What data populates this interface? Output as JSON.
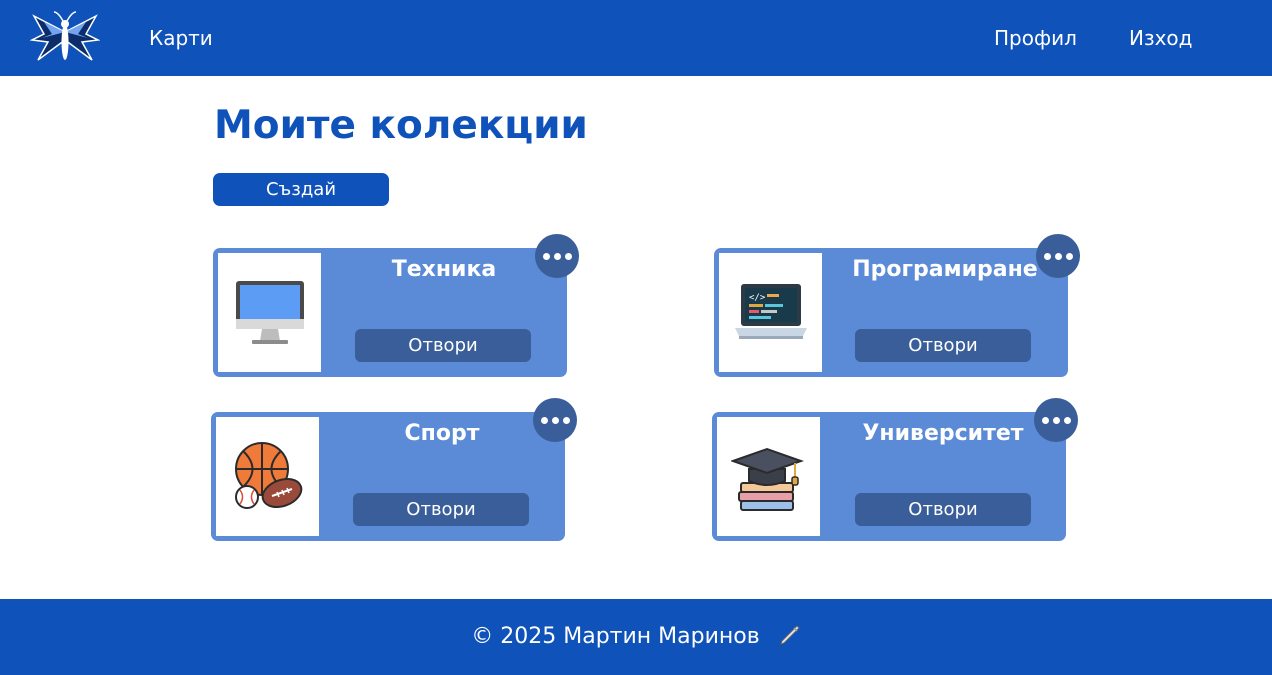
{
  "nav": {
    "logo_icon": "butterfly-logo-icon",
    "cards_label": "Карти",
    "profile_label": "Профил",
    "logout_label": "Изход"
  },
  "page": {
    "title": "Моите колекции",
    "create_label": "Създай"
  },
  "collections": [
    {
      "title": "Техника",
      "open_label": "Отвори",
      "icon": "computer-monitor-icon"
    },
    {
      "title": "Програмиране",
      "open_label": "Отвори",
      "icon": "laptop-code-icon"
    },
    {
      "title": "Спорт",
      "open_label": "Отвори",
      "icon": "sports-balls-icon"
    },
    {
      "title": "Университет",
      "open_label": "Отвори",
      "icon": "graduation-cap-books-icon"
    }
  ],
  "footer": {
    "text": "© 2025 Мартин Маринов",
    "icon": "pen-icon"
  },
  "colors": {
    "primary": "#0f52ba",
    "card": "#5b8bd7",
    "button_dark": "#3a5e99"
  }
}
